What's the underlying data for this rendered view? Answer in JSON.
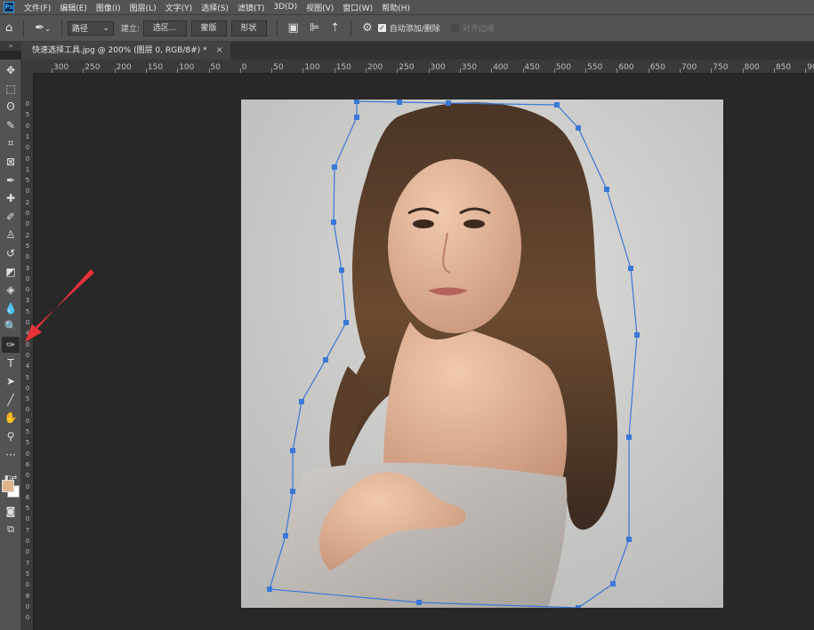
{
  "menu": {
    "logo": "Ps",
    "items": [
      "文件(F)",
      "编辑(E)",
      "图像(I)",
      "图层(L)",
      "文字(Y)",
      "选择(S)",
      "滤镜(T)",
      "3D(D)",
      "视图(V)",
      "窗口(W)",
      "帮助(H)"
    ]
  },
  "options": {
    "mode_value": "路径",
    "make_label": "建立:",
    "selection_button": "选区...",
    "mask_button": "蒙版",
    "shape_button": "形状",
    "auto_add_delete": "自动添加/删除",
    "auto_add_delete_checked": true,
    "align_edges": "对齐边缘",
    "align_edges_checked": false
  },
  "document": {
    "tab_title": "快速选择工具.jpg @ 200% (图层 0, RGB/8#) *",
    "close": "×"
  },
  "ruler": {
    "horizontal_labels": [
      "300",
      "250",
      "200",
      "150",
      "100",
      "50",
      "0",
      "50",
      "100",
      "150",
      "200",
      "250",
      "300",
      "350",
      "400",
      "450",
      "500",
      "550",
      "600",
      "650",
      "700",
      "750",
      "800",
      "850",
      "90"
    ],
    "vertical_labels": [
      "0",
      "5",
      "0",
      "1",
      "0",
      "0",
      "1",
      "5",
      "0",
      "2",
      "0",
      "0",
      "2",
      "5",
      "0",
      "3",
      "0",
      "0",
      "3",
      "5",
      "0",
      "4",
      "0",
      "0",
      "4",
      "5",
      "0",
      "5",
      "0",
      "0",
      "5",
      "5",
      "0",
      "6",
      "0",
      "0",
      "6",
      "5",
      "0",
      "7",
      "0",
      "0",
      "7",
      "5",
      "0",
      "8",
      "0",
      "0"
    ]
  },
  "tools": [
    {
      "name": "move-tool",
      "glyph": "✥"
    },
    {
      "name": "marquee-tool",
      "glyph": "⬚"
    },
    {
      "name": "lasso-tool",
      "glyph": "ʘ"
    },
    {
      "name": "quick-selection-tool",
      "glyph": "✎"
    },
    {
      "name": "crop-tool",
      "glyph": "⌗"
    },
    {
      "name": "frame-tool",
      "glyph": "⊠"
    },
    {
      "name": "eyedropper-tool",
      "glyph": "✒"
    },
    {
      "name": "healing-brush-tool",
      "glyph": "✚"
    },
    {
      "name": "brush-tool",
      "glyph": "✐"
    },
    {
      "name": "clone-stamp-tool",
      "glyph": "♙"
    },
    {
      "name": "history-brush-tool",
      "glyph": "↺"
    },
    {
      "name": "eraser-tool",
      "glyph": "◩"
    },
    {
      "name": "paint-bucket-tool",
      "glyph": "◈"
    },
    {
      "name": "blur-tool",
      "glyph": "💧"
    },
    {
      "name": "dodge-tool",
      "glyph": "🔍"
    },
    {
      "name": "pen-tool",
      "glyph": "✑"
    },
    {
      "name": "type-tool",
      "glyph": "T"
    },
    {
      "name": "path-selection-tool",
      "glyph": "➤"
    },
    {
      "name": "line-tool",
      "glyph": "╱"
    },
    {
      "name": "hand-tool",
      "glyph": "✋"
    },
    {
      "name": "zoom-tool",
      "glyph": "⚲"
    },
    {
      "name": "more-tools",
      "glyph": "···"
    }
  ],
  "colors": {
    "foreground": "#e1b58c",
    "background": "#ffffff",
    "path": "#3a78d6",
    "arrow": "#e8323a"
  }
}
